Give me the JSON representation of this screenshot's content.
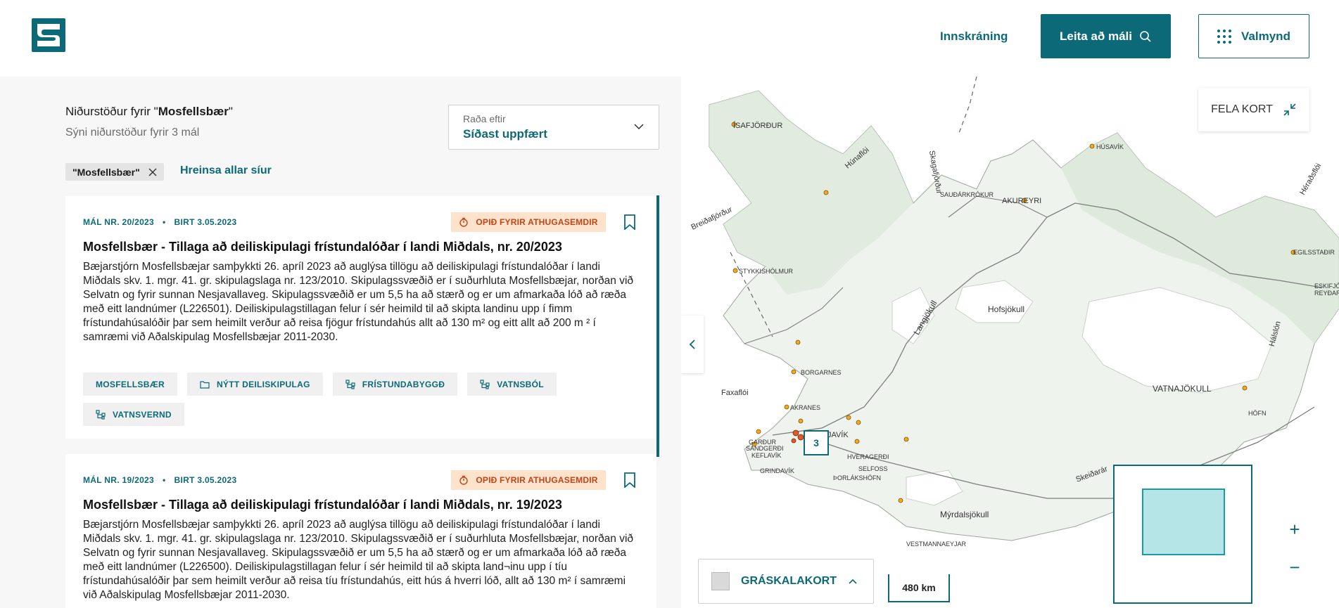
{
  "header": {
    "login_label": "Innskráning",
    "search_label": "Leita að máli",
    "menu_label": "Valmynd"
  },
  "results": {
    "title_prefix": "Niðurstöður fyrir \"",
    "query": "Mosfellsbær",
    "title_suffix": "\"",
    "subtitle": "Sýni niðurstöður fyrir 3 mál",
    "sort_label": "Raða eftir",
    "sort_value": "Síðast uppfært",
    "filter_chip": "\"Mosfellsbær\"",
    "clear_filters": "Hreinsa allar síur"
  },
  "cards": [
    {
      "case_no": "MÁL NR. 20/2023",
      "published": "BIRT 3.05.2023",
      "status": "OPIÐ FYRIR ATHUGASEMDIR",
      "title": "Mosfellsbær - Tillaga að deiliskipulagi frístundalóðar í landi Miðdals, nr. 20/2023",
      "text": "Bæjarstjórn Mosfellsbæjar samþykkti 26. apríl 2023 að auglýsa tillögu að deiliskipulagi frístundalóðar í landi Miðdals skv. 1. mgr. 41. gr. skipulagslaga nr. 123/2010. Skipulagssvæðið er í suðurhluta Mosfellsbæjar, norðan við Selvatn og fyrir sunnan Nesjavallaveg. Skipulagssvæðið er um 5,5 ha að stærð og er um afmarkaða lóð að ræða með eitt landnúmer (L226501). Deiliskipulagstillagan felur í sér heimild til að skipta landinu upp í fimm frístundahúsalóðir þar sem heimilt verður að reisa fjögur frístundahús allt að 130 m² og eitt allt að 200 m ² í samræmi við Aðalskipulag Mosfellsbæjar 2011-2030.",
      "tags": [
        "MOSFELLSBÆR",
        "NÝTT DEILISKIPULAG",
        "FRÍSTUNDABYGGÐ",
        "VATNSBÓL",
        "VATNSVERND"
      ]
    },
    {
      "case_no": "MÁL NR. 19/2023",
      "published": "BIRT 3.05.2023",
      "status": "OPIÐ FYRIR ATHUGASEMDIR",
      "title": "Mosfellsbær - Tillaga að deiliskipulagi frístundalóðar í landi Miðdals, nr. 19/2023",
      "text": "Bæjarstjórn Mosfellsbæjar samþykkti 26. apríl 2023 að auglýsa tillögu að deiliskipulagi frístundalóðar í landi Miðdals skv. 1. mgr. 41. gr. skipulagslaga nr. 123/2010. Skipulagssvæðið er í suðurhluta Mosfellsbæjar, norðan við Selvatn og fyrir sunnan Nesjavallaveg. Skipulagssvæðið er um 5,5 ha að stærð og er um afmarkaða lóð að ræða með eitt landnúmer (L226500). Deiliskipulagstillagan felur í sér heimild til að skipta land¬inu upp í tíu frístundahúsalóðir þar sem heimilt verður að reisa tíu frístundahús, eitt hús á hverri lóð, allt að 130 m² í samræmi við Aðalskipulag Mosfellsbæjar 2011-2030."
    }
  ],
  "map": {
    "hide_label": "FELA KORT",
    "cluster_count": "3",
    "basemap_label": "GRÁSKALAKORT",
    "scale_label": "480 km",
    "labels": [
      "ÍSAFJÖRÐUR",
      "Húnaflói",
      "Skagafjörður",
      "SAUÐÁRKRÓKUR",
      "AKUREYRI",
      "HÚSAVÍK",
      "Héraðsflói",
      "EGILSSTAÐIR",
      "ESKIFJÖRÐUR",
      "REYÐARFJÖRÐUR",
      "Breiðafjörður",
      "STYKKISHÓLMUR",
      "Hofsjökull",
      "Langjökull",
      "BORGARNES",
      "VATNAJÖKULL",
      "Faxaflói",
      "AKRANES",
      "REYKJAVÍK",
      "GARÐUR",
      "SANDGERÐI",
      "KEFLAVÍK",
      "GRINDAVÍK",
      "HVERAGERÐI",
      "SELFOSS",
      "ÞORLÁKSHÖFN",
      "Mýrdalsjökull",
      "VESTMANNAEYJAR",
      "HÖFN",
      "Skeiðarár",
      "Hálslón"
    ]
  }
}
